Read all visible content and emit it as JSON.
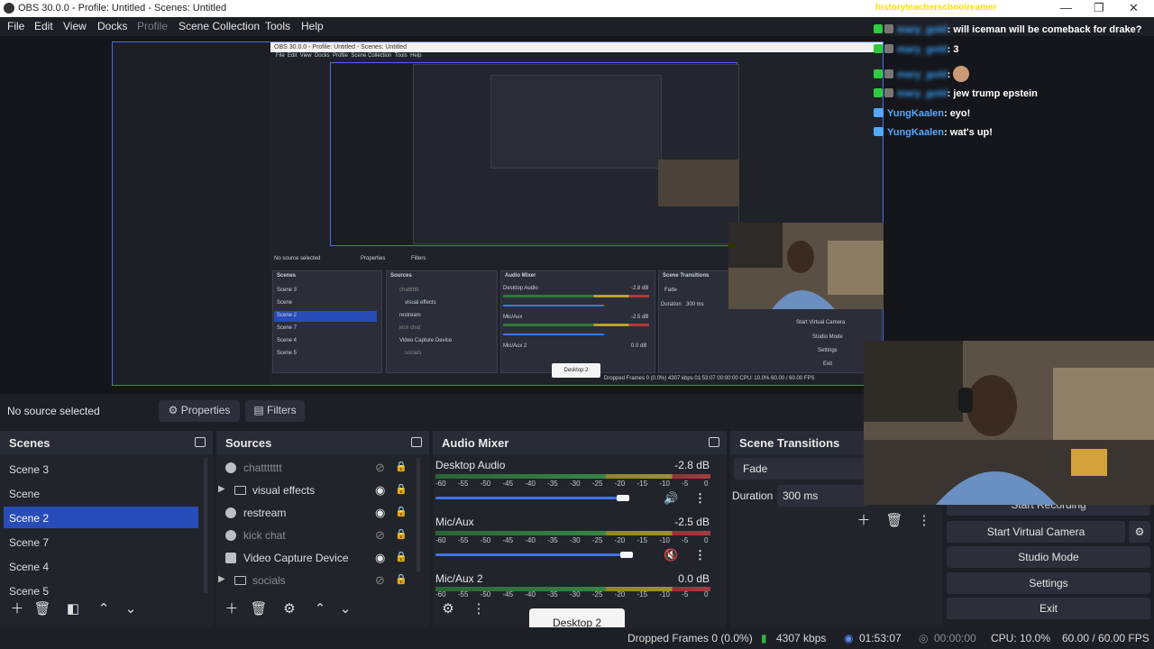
{
  "window": {
    "title": "OBS 30.0.0 - Profile: Untitled - Scenes: Untitled",
    "controls": {
      "minimize": "—",
      "restore": "❐",
      "close": "✕"
    }
  },
  "menu": [
    "File",
    "Edit",
    "View",
    "Docks",
    "Profile",
    "Scene Collection",
    "Tools",
    "Help"
  ],
  "chat": {
    "header_user": "historyteacherschoolreamer",
    "messages": [
      {
        "user": "mary_gold",
        "text": ": will iceman will be comeback for drake?",
        "platform": "kick"
      },
      {
        "user": "mary_gold",
        "text": ": 3",
        "platform": "kick"
      },
      {
        "user": "mary_gold",
        "text": ":",
        "platform": "kick"
      },
      {
        "user": "mary_gold",
        "text": ": jew trump epstein",
        "platform": "kick"
      },
      {
        "user": "YungKaalen",
        "text": ": eyo!",
        "platform": "twitch"
      },
      {
        "user": "YungKaalen",
        "text": ": wat's up!",
        "platform": "twitch"
      }
    ]
  },
  "nested": {
    "title": "OBS 30.0.0 - Profile: Untitled - Scenes: Untitled",
    "menu": [
      "File",
      "Edit",
      "View",
      "Docks",
      "Profile",
      "Scene Collection",
      "Tools",
      "Help"
    ],
    "no_source": "No source selected",
    "properties": "Properties",
    "filters": "Filters",
    "scenes_title": "Scenes",
    "sources_title": "Sources",
    "mixer_title": "Audio Mixer",
    "transitions_title": "Scene Transitions",
    "scenes": [
      "Scene 3",
      "Scene",
      "Scene 2",
      "Scene 7",
      "Scene 4",
      "Scene 5"
    ],
    "sources": [
      "chattttttt",
      "visual effects",
      "restream",
      "kick chat",
      "Video Capture Device",
      "socials"
    ],
    "ch1": "Desktop Audio",
    "ch1_db": "-2.8 dB",
    "ch2": "Mic/Aux",
    "ch2_db": "-2.5 dB",
    "ch3": "Mic/Aux 2",
    "ch3_db": "0.0 dB",
    "fade": "Fade",
    "duration_label": "Duration",
    "duration": "300 ms",
    "virtual_cam": "Start Virtual Camera",
    "studio": "Studio Mode",
    "settings": "Settings",
    "exit": "Exit",
    "tooltip": "Desktop 2",
    "status": "Dropped Frames 0 (0.0%)    4307 kbps    01:53:07    00:00:00    CPU: 10.0%    60.00 / 60.00 FPS"
  },
  "source_bar": {
    "no_source": "No source selected",
    "properties": "Properties",
    "filters": "Filters"
  },
  "scenes": {
    "title": "Scenes",
    "items": [
      "Scene 3",
      "Scene",
      "Scene 2",
      "Scene 7",
      "Scene 4",
      "Scene 5"
    ],
    "selected_index": 2
  },
  "sources": {
    "title": "Sources",
    "items": [
      {
        "name": "chattttttt",
        "type": "browser",
        "visible": false
      },
      {
        "name": "visual effects",
        "type": "group",
        "visible": true
      },
      {
        "name": "restream",
        "type": "browser",
        "visible": true
      },
      {
        "name": "kick chat",
        "type": "browser",
        "visible": false
      },
      {
        "name": "Video Capture Device",
        "type": "camera",
        "visible": true
      },
      {
        "name": "socials",
        "type": "group",
        "visible": false
      }
    ]
  },
  "mixer": {
    "title": "Audio Mixer",
    "scale": [
      "-60",
      "-55",
      "-50",
      "-45",
      "-40",
      "-35",
      "-30",
      "-25",
      "-20",
      "-15",
      "-10",
      "-5",
      "0"
    ],
    "channels": [
      {
        "name": "Desktop Audio",
        "db": "-2.8 dB",
        "level": 0.95,
        "muted": false
      },
      {
        "name": "Mic/Aux",
        "db": "-2.5 dB",
        "level": 0.98,
        "muted": true
      },
      {
        "name": "Mic/Aux 2",
        "db": "0.0 dB",
        "level": 1.0,
        "muted": false
      }
    ]
  },
  "transitions": {
    "title": "Scene Transitions",
    "type": "Fade",
    "duration_label": "Duration",
    "duration": "300 ms"
  },
  "controls": {
    "start_recording": "Start Recording",
    "virtual_camera": "Start Virtual Camera",
    "studio_mode": "Studio Mode",
    "settings": "Settings",
    "exit": "Exit"
  },
  "tooltip": "Desktop 2",
  "status": {
    "dropped": "Dropped Frames 0 (0.0%)",
    "bitrate": "4307 kbps",
    "stream_time": "01:53:07",
    "rec_time": "00:00:00",
    "cpu": "CPU: 10.0%",
    "fps": "60.00 / 60.00 FPS"
  },
  "colors": {
    "accent": "#284cb8",
    "fader": "#3f73e8",
    "preview_border": "#4a6ee0",
    "bg": "#1d1f26"
  }
}
